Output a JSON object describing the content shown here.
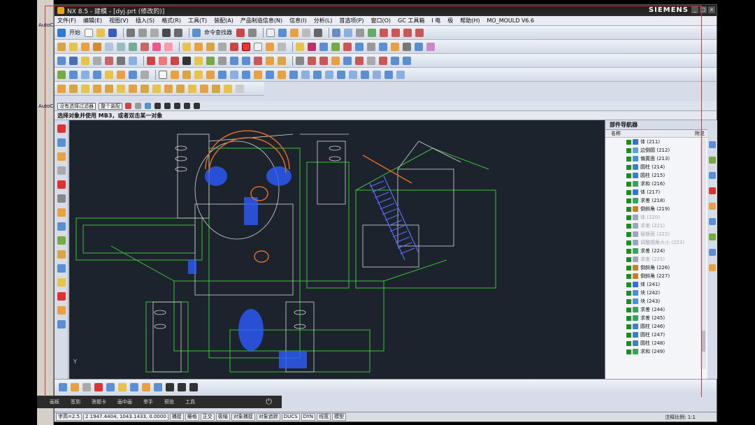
{
  "window": {
    "title": "NX 8.5 - 建模 - [dyj.prt (修改的)]",
    "brand": "SIEMENS",
    "controls": [
      "_",
      "□",
      "×"
    ]
  },
  "background_app": {
    "label1": "AutoCa",
    "label2": "AutoCa"
  },
  "menu": [
    "文件(F)",
    "编辑(E)",
    "视图(V)",
    "插入(S)",
    "格式(R)",
    "工具(T)",
    "装配(A)",
    "产品制造信息(N)",
    "信息(I)",
    "分析(L)",
    "首选项(P)",
    "窗口(O)",
    "GC 工具箱",
    "I 电",
    "极",
    "帮助(H)",
    "MO_MOULD V6.6"
  ],
  "toolbar1": {
    "start_label": "开始",
    "command_finder_label": "命令查找器"
  },
  "selection_bar": {
    "filter": "没有选择过滤器",
    "scope": "整个装配"
  },
  "cue_line": "选择对象并使用 MB3，或者双击某一对象",
  "part_navigator": {
    "title": "部件导航器",
    "col_name": "名称",
    "col_updated": "附注",
    "items": [
      {
        "label": "体 (211)",
        "color": "#3a6fd8",
        "dim": false
      },
      {
        "label": "边倒圆 (212)",
        "color": "#5aa1e0",
        "dim": false
      },
      {
        "label": "偏置面 (213)",
        "color": "#4c8fd4",
        "dim": false
      },
      {
        "label": "圆柱 (214)",
        "color": "#3b7fc9",
        "dim": false
      },
      {
        "label": "圆柱 (215)",
        "color": "#3b7fc9",
        "dim": false
      },
      {
        "label": "求和 (216)",
        "color": "#3aa35a",
        "dim": false
      },
      {
        "label": "体 (217)",
        "color": "#3a6fd8",
        "dim": false
      },
      {
        "label": "求差 (218)",
        "color": "#3aa35a",
        "dim": false
      },
      {
        "label": "倒斜角 (219)",
        "color": "#c77d2a",
        "dim": false
      },
      {
        "label": "体 (220)",
        "color": "#9aa7c0",
        "dim": true
      },
      {
        "label": "求差 (221)",
        "color": "#9aa7c0",
        "dim": true
      },
      {
        "label": "替换面 (222)",
        "color": "#9aa7c0",
        "dim": true
      },
      {
        "label": "调整圆角大小 (223)",
        "color": "#9aa7c0",
        "dim": true
      },
      {
        "label": "求差 (224)",
        "color": "#3aa35a",
        "dim": false
      },
      {
        "label": "求差 (225)",
        "color": "#9aa7c0",
        "dim": true
      },
      {
        "label": "倒斜角 (226)",
        "color": "#c77d2a",
        "dim": false
      },
      {
        "label": "倒斜角 (227)",
        "color": "#c77d2a",
        "dim": false
      },
      {
        "label": "体 (241)",
        "color": "#3a6fd8",
        "dim": false
      },
      {
        "label": "块 (242)",
        "color": "#4c8fd4",
        "dim": false
      },
      {
        "label": "块 (243)",
        "color": "#4c8fd4",
        "dim": false
      },
      {
        "label": "求差 (244)",
        "color": "#3aa35a",
        "dim": false
      },
      {
        "label": "求差 (245)",
        "color": "#3aa35a",
        "dim": false
      },
      {
        "label": "圆柱 (246)",
        "color": "#3b7fc9",
        "dim": false
      },
      {
        "label": "圆柱 (247)",
        "color": "#3b7fc9",
        "dim": false
      },
      {
        "label": "圆柱 (248)",
        "color": "#3b7fc9",
        "dim": false
      },
      {
        "label": "求和 (249)",
        "color": "#3aa35a",
        "dim": false
      }
    ]
  },
  "triad": {
    "y": "Y",
    "x": "X"
  },
  "status": {
    "coords": "2 1947.4404, 1043.1433, 0.0000",
    "prefix": "字高=2.5",
    "toggles": [
      "捕捉",
      "栅格",
      "正交",
      "极轴",
      "对象捕捉",
      "对象追踪",
      "DUCS",
      "DYN",
      "线宽",
      "模型"
    ],
    "scale": "注释比例: 1:1"
  },
  "overlay": {
    "items": [
      "画板",
      "签到",
      "答题卡",
      "画中画",
      "举手",
      "预览",
      "工具"
    ],
    "power_icon": "power-icon"
  },
  "colors": {
    "viewport_bg": "#1d232c",
    "wire_green": "#3ac23a",
    "wire_blue": "#2c5cff",
    "wire_white": "#d8d8d8",
    "wire_orange": "#e06a2a"
  }
}
